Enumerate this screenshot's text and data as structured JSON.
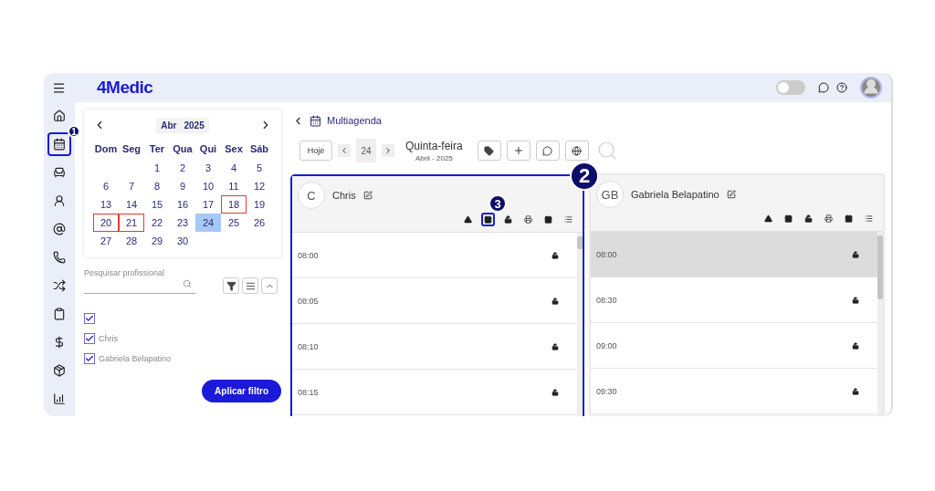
{
  "topbar": {
    "logo": "4Medic",
    "theme_toggle": {
      "on": false
    }
  },
  "calendar": {
    "month": "Abr",
    "year": "2025",
    "weekdays": [
      "Dom",
      "Seg",
      "Ter",
      "Qua",
      "Qui",
      "Sex",
      "Sáb"
    ],
    "weeks": [
      [
        {
          "day": "1",
          "selected": false,
          "marked": false
        },
        {
          "day": "2",
          "selected": false,
          "marked": false
        },
        {
          "day": "3",
          "selected": false,
          "marked": false
        },
        {
          "day": "4",
          "selected": false,
          "marked": false
        },
        {
          "day": "5",
          "selected": false,
          "marked": false
        }
      ],
      [
        {
          "day": "6",
          "selected": false,
          "marked": false
        },
        {
          "day": "7",
          "selected": false,
          "marked": false
        },
        {
          "day": "8",
          "selected": false,
          "marked": false
        },
        {
          "day": "9",
          "selected": false,
          "marked": false
        },
        {
          "day": "10",
          "selected": false,
          "marked": false
        },
        {
          "day": "11",
          "selected": false,
          "marked": false
        },
        {
          "day": "12",
          "selected": false,
          "marked": false
        }
      ],
      [
        {
          "day": "13",
          "selected": false,
          "marked": false
        },
        {
          "day": "14",
          "selected": false,
          "marked": false
        },
        {
          "day": "15",
          "selected": false,
          "marked": false
        },
        {
          "day": "16",
          "selected": false,
          "marked": false
        },
        {
          "day": "17",
          "selected": false,
          "marked": false
        },
        {
          "day": "18",
          "selected": false,
          "marked": true
        },
        {
          "day": "19",
          "selected": false,
          "marked": false
        }
      ],
      [
        {
          "day": "20",
          "selected": false,
          "marked": true
        },
        {
          "day": "21",
          "selected": false,
          "marked": true
        },
        {
          "day": "22",
          "selected": false,
          "marked": false
        },
        {
          "day": "23",
          "selected": false,
          "marked": false
        },
        {
          "day": "24",
          "selected": true,
          "marked": false
        },
        {
          "day": "25",
          "selected": false,
          "marked": false
        },
        {
          "day": "26",
          "selected": false,
          "marked": false
        }
      ],
      [
        {
          "day": "27",
          "selected": false,
          "marked": false
        },
        {
          "day": "28",
          "selected": false,
          "marked": false
        },
        {
          "day": "29",
          "selected": false,
          "marked": false
        },
        {
          "day": "30",
          "selected": false,
          "marked": false
        }
      ]
    ]
  },
  "professional_filter": {
    "search": {
      "placeholder": "Pesquisar profissional"
    },
    "options": [
      {
        "checked": true
      },
      {
        "label": "Chris",
        "checked": true
      },
      {
        "label": "Gabriela Belapatino",
        "checked": true
      }
    ],
    "apply_button": "Aplicar filtro"
  },
  "header": {
    "title": "Multiagenda"
  },
  "day_nav": {
    "today_button": "Hoje",
    "day": "24",
    "weekday": "Quinta-feira",
    "month_year": "Abril - 2025"
  },
  "columns": [
    {
      "initials": "C",
      "name": "Chris",
      "slots": [
        {
          "time": "08:00",
          "highlighted": false
        },
        {
          "time": "08:05",
          "highlighted": false
        },
        {
          "time": "08:10",
          "highlighted": false
        },
        {
          "time": "08:15",
          "highlighted": false
        }
      ]
    },
    {
      "initials": "GB",
      "name": "Gabriela Belapatino",
      "slots": [
        {
          "time": "08:00",
          "highlighted": true
        },
        {
          "time": "08:30",
          "highlighted": false
        },
        {
          "time": "09:00",
          "highlighted": false
        },
        {
          "time": "09:30",
          "highlighted": false
        }
      ]
    }
  ],
  "annotations": [
    {
      "label": "1"
    },
    {
      "label": "2"
    },
    {
      "label": "3"
    }
  ]
}
